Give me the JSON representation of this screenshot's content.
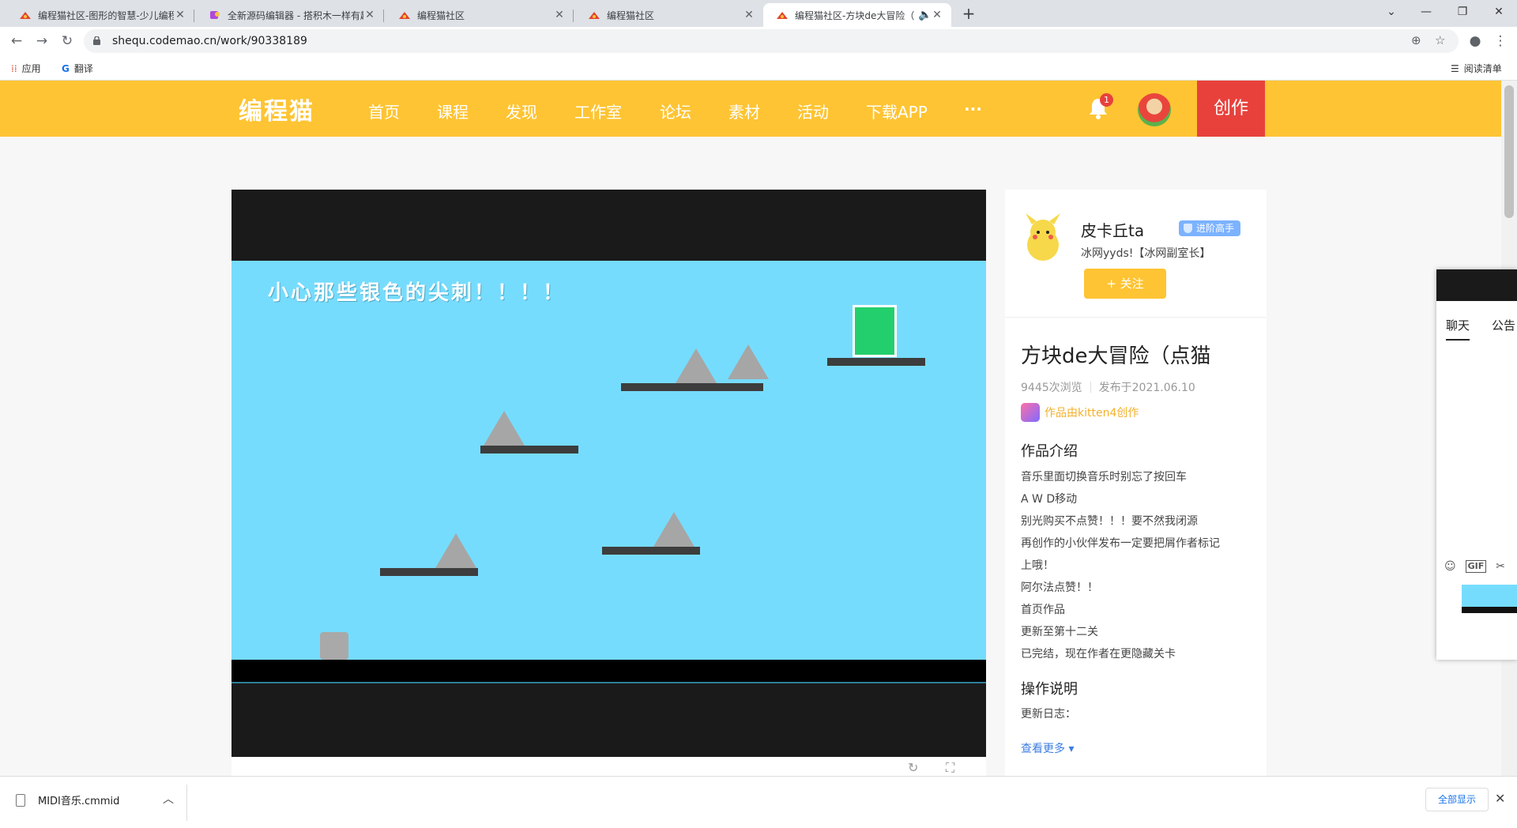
{
  "browser": {
    "tabs": [
      {
        "title": "编程猫社区-图形的智慧-少儿编程",
        "active": false
      },
      {
        "title": "全新源码编辑器 - 搭积木一样有趣",
        "active": false
      },
      {
        "title": "编程猫社区",
        "active": false
      },
      {
        "title": "编程猫社区",
        "active": false
      },
      {
        "title": "编程猫社区-方块de大冒险（",
        "active": true
      }
    ],
    "url": "shequ.codemao.cn/work/90338189",
    "bookmarks": {
      "apps": "应用",
      "translate": "翻译",
      "reading_list": "阅读清单"
    }
  },
  "site": {
    "logo": "编程猫",
    "nav": [
      "首页",
      "课程",
      "发现",
      "工作室",
      "论坛",
      "素材",
      "活动",
      "下载APP",
      "···"
    ],
    "notification_count": "1",
    "create_label": "创作"
  },
  "game": {
    "hint_text": "小心那些银色的尖刺！！！！"
  },
  "author": {
    "name": "皮卡丘ta",
    "level_badge": "进阶高手",
    "motto": "冰网yyds!【冰网副室长】",
    "follow_label": "+ 关注"
  },
  "work": {
    "title": "方块de大冒险（点猫",
    "views": "9445次浏览",
    "published": "发布于2021.06.10",
    "made_by": "作品由kitten4创作",
    "intro_heading": "作品介绍",
    "intro_lines": [
      "音乐里面切换音乐时别忘了按回车",
      "A  W  D移动",
      "别光购买不点赞！！！要不然我闭源",
      "再创作的小伙伴发布一定要把屑作者标记",
      "上哦！",
      "阿尔法点赞！！",
      "首页作品",
      "更新至第十二关",
      "已完结，现在作者在更隐藏关卡"
    ],
    "ops_heading": "操作说明",
    "ops_text": "更新日志：",
    "see_more": "查看更多 ▾"
  },
  "chat": {
    "tabs": [
      "聊天",
      "公告"
    ],
    "tools": [
      "☺",
      "GIF",
      "✂"
    ]
  },
  "downloads": {
    "file_name": "MIDI音乐.cmmid",
    "show_all": "全部显示"
  },
  "colors": {
    "brand": "#fec433",
    "create": "#e8413c",
    "stage": "#76dcfd",
    "goal": "#23cf6c",
    "link": "#3c7de1"
  }
}
